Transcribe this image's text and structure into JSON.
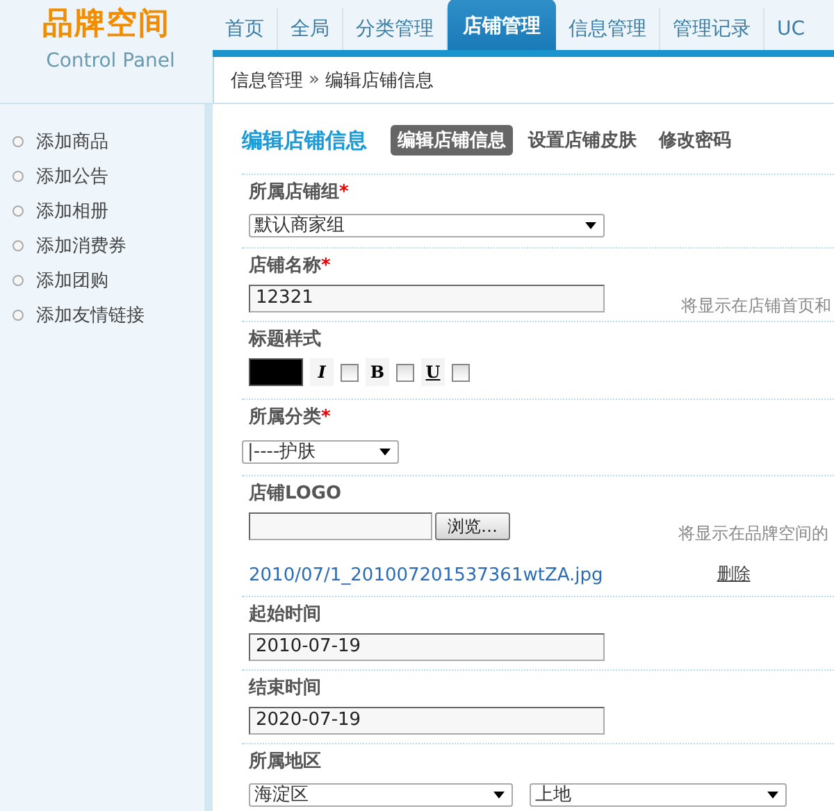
{
  "logo": {
    "title": "品牌空间",
    "subtitle": "Control Panel"
  },
  "nav": [
    {
      "label": "首页",
      "selected": false
    },
    {
      "label": "全局",
      "selected": false
    },
    {
      "label": "分类管理",
      "selected": false
    },
    {
      "label": "店铺管理",
      "selected": true
    },
    {
      "label": "信息管理",
      "selected": false
    },
    {
      "label": "管理记录",
      "selected": false
    },
    {
      "label": "UC",
      "selected": false
    }
  ],
  "breadcrumb": {
    "parent": "信息管理",
    "separator": "»",
    "current": "编辑店铺信息"
  },
  "sidebar": {
    "items": [
      "添加商品",
      "添加公告",
      "添加相册",
      "添加消费券",
      "添加团购",
      "添加友情链接"
    ]
  },
  "form": {
    "title": "编辑店铺信息",
    "required_mark": "*",
    "tabs": [
      {
        "label": "编辑店铺信息",
        "selected": true
      },
      {
        "label": "设置店铺皮肤",
        "selected": false
      },
      {
        "label": "修改密码",
        "selected": false
      }
    ],
    "fields": [
      {
        "kind": "select",
        "label": "所属店铺组",
        "required": true,
        "value": "默认商家组"
      },
      {
        "kind": "text",
        "label": "店铺名称",
        "required": true,
        "value": "12321",
        "hint": "将显示在店铺首页和"
      },
      {
        "kind": "style",
        "label": "标题样式",
        "required": false,
        "color": "#000000",
        "options": [
          {
            "kind": "italic",
            "label": "I",
            "checked": false
          },
          {
            "kind": "bold",
            "label": "B",
            "checked": false
          },
          {
            "kind": "underline",
            "label": "U",
            "checked": false
          }
        ]
      },
      {
        "kind": "short-select",
        "label": "所属分类",
        "required": true,
        "value": "|----护肤"
      },
      {
        "kind": "file",
        "label": "店铺LOGO",
        "required": false,
        "button": "浏览…",
        "hint": "将显示在品牌空间的",
        "file": "2010/07/1_201007201537361wtZA.jpg",
        "delete": "删除"
      },
      {
        "kind": "text",
        "label": "起始时间",
        "required": false,
        "value": "2010-07-19"
      },
      {
        "kind": "text",
        "label": "结束时间",
        "required": false,
        "value": "2020-07-19"
      },
      {
        "kind": "region",
        "label": "所属地区",
        "required": false,
        "values": [
          "海淀区",
          "上地"
        ]
      }
    ]
  }
}
